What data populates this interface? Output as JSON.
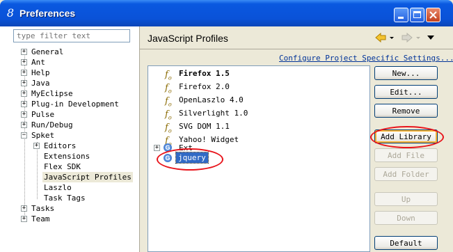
{
  "window": {
    "title": "Preferences",
    "app_icon": "eclipse-8-icon"
  },
  "filter": {
    "placeholder": "type filter text"
  },
  "tree": [
    {
      "label": "General",
      "expander": "+"
    },
    {
      "label": "Ant",
      "expander": "+"
    },
    {
      "label": "Help",
      "expander": "+"
    },
    {
      "label": "Java",
      "expander": "+"
    },
    {
      "label": "MyEclipse",
      "expander": "+"
    },
    {
      "label": "Plug-in Development",
      "expander": "+"
    },
    {
      "label": "Pulse",
      "expander": "+"
    },
    {
      "label": "Run/Debug",
      "expander": "+"
    },
    {
      "label": "Spket",
      "expander": "−"
    },
    {
      "label": "Editors",
      "expander": "+"
    },
    {
      "label": "Extensions"
    },
    {
      "label": "Flex SDK"
    },
    {
      "label": "JavaScript Profiles"
    },
    {
      "label": "Laszlo"
    },
    {
      "label": "Task Tags"
    },
    {
      "label": "Tasks",
      "expander": "+"
    },
    {
      "label": "Team",
      "expander": "+"
    }
  ],
  "page": {
    "title": "JavaScript Profiles",
    "config_link": "Configure Project Specific Settings..."
  },
  "profiles": [
    {
      "label": "Firefox 1.5",
      "icon": "fx",
      "bold": true
    },
    {
      "label": "Firefox 2.0",
      "icon": "fx"
    },
    {
      "label": "OpenLaszlo 4.0",
      "icon": "fx"
    },
    {
      "label": "Silverlight 1.0",
      "icon": "fx"
    },
    {
      "label": "SVG DOM 1.1",
      "icon": "fx"
    },
    {
      "label": "Yahoo! Widget",
      "icon": "fx"
    },
    {
      "label": "Ext",
      "icon": "G"
    },
    {
      "label": "jquery",
      "icon": "G"
    }
  ],
  "buttons": {
    "new": "New...",
    "edit": "Edit...",
    "remove": "Remove",
    "add_library": "Add Library",
    "add_file": "Add File",
    "add_folder": "Add Folder",
    "up": "Up",
    "down": "Down",
    "default": "Default"
  },
  "colors": {
    "annotation": "#E8141B",
    "title_bar": "#0A52D8",
    "selection": "#316AC5"
  }
}
